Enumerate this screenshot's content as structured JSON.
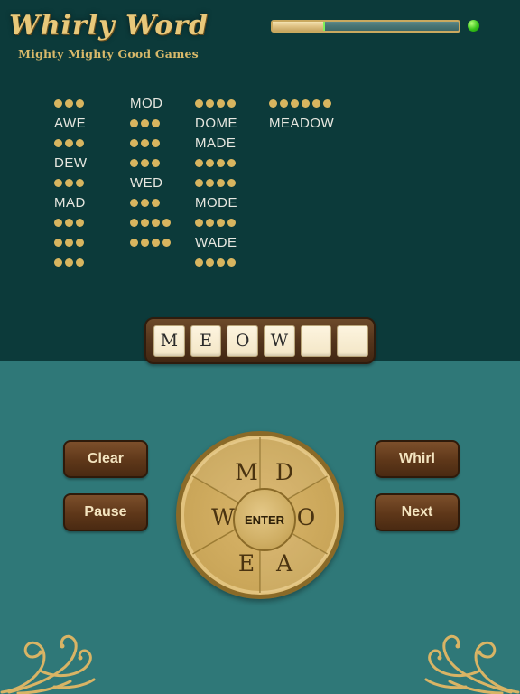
{
  "header": {
    "logo_title": "Whirly Word",
    "logo_subtitle": "Mighty Mighty Good Games",
    "progress_percent": 27,
    "status_dot_color": "#37c41a",
    "accent_gold": "#d8b55f",
    "panel_dark": "#0c3a3a",
    "panel_teal": "#2f7878"
  },
  "word_grid": {
    "columns": [
      {
        "slots": [
          {
            "type": "dots",
            "count": 3
          },
          {
            "type": "word",
            "text": "AWE"
          },
          {
            "type": "dots",
            "count": 3
          },
          {
            "type": "word",
            "text": "DEW"
          },
          {
            "type": "dots",
            "count": 3
          },
          {
            "type": "word",
            "text": "MAD"
          },
          {
            "type": "dots",
            "count": 3
          },
          {
            "type": "dots",
            "count": 3
          },
          {
            "type": "dots",
            "count": 3
          }
        ]
      },
      {
        "slots": [
          {
            "type": "word",
            "text": "MOD"
          },
          {
            "type": "dots",
            "count": 3
          },
          {
            "type": "dots",
            "count": 3
          },
          {
            "type": "dots",
            "count": 3
          },
          {
            "type": "word",
            "text": "WED"
          },
          {
            "type": "dots",
            "count": 3
          },
          {
            "type": "dots",
            "count": 4
          },
          {
            "type": "dots",
            "count": 4
          }
        ]
      },
      {
        "slots": [
          {
            "type": "dots",
            "count": 4
          },
          {
            "type": "word",
            "text": "DOME"
          },
          {
            "type": "word",
            "text": "MADE"
          },
          {
            "type": "dots",
            "count": 4
          },
          {
            "type": "dots",
            "count": 4
          },
          {
            "type": "word",
            "text": "MODE"
          },
          {
            "type": "dots",
            "count": 4
          },
          {
            "type": "word",
            "text": "WADE"
          },
          {
            "type": "dots",
            "count": 4
          }
        ]
      },
      {
        "slots": [
          {
            "type": "dots",
            "count": 6
          },
          {
            "type": "word",
            "text": "MEADOW"
          }
        ]
      }
    ]
  },
  "rack": {
    "tiles": [
      {
        "letter": "M",
        "filled": true
      },
      {
        "letter": "E",
        "filled": true
      },
      {
        "letter": "O",
        "filled": true
      },
      {
        "letter": "W",
        "filled": true
      },
      {
        "letter": "",
        "filled": false
      },
      {
        "letter": "",
        "filled": false
      }
    ]
  },
  "controls": {
    "clear_label": "Clear",
    "pause_label": "Pause",
    "whirl_label": "Whirl",
    "next_label": "Next"
  },
  "wheel": {
    "center_label": "ENTER",
    "letters": [
      "M",
      "D",
      "O",
      "A",
      "E",
      "W"
    ]
  }
}
